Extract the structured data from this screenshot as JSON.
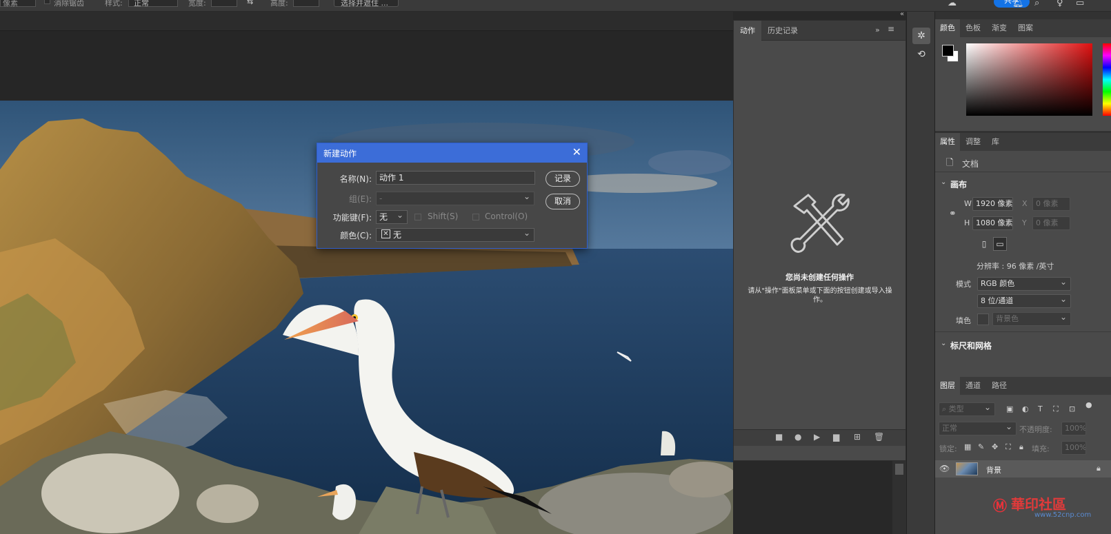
{
  "options_bar": {
    "px_label": "像素",
    "antialias_label": "消除锯齿",
    "style_label": "样式:",
    "style_value": "正常",
    "width_label": "宽度:",
    "height_label": "高度:",
    "swap_icon": "swap-arrow-icon",
    "select_mask_label": "选择并遮住 ...",
    "share_label": "共享"
  },
  "actions_panel": {
    "tabs": [
      "动作",
      "历史记录"
    ],
    "empty_title": "您尚未创建任何操作",
    "empty_desc": "请从\"操作\"面板菜单或下面的按钮创建或导入操作。"
  },
  "color_panel": {
    "tabs": [
      "颜色",
      "色板",
      "渐变",
      "图案"
    ],
    "foreground": "#000000",
    "background": "#ffffff"
  },
  "properties_panel": {
    "tabs": [
      "属性",
      "调整",
      "库"
    ],
    "doc_label": "文档",
    "canvas_section": "画布",
    "w_label": "W",
    "w_value": "1920 像素",
    "h_label": "H",
    "h_value": "1080 像素",
    "x_label": "X",
    "x_value": "0 像素",
    "y_label": "Y",
    "y_value": "0 像素",
    "resolution": "分辨率 : 96 像素 /英寸",
    "mode_label": "模式",
    "mode_value": "RGB 颜色",
    "depth_value": "8 位/通道",
    "fill_label": "填色",
    "fill_value": "背景色",
    "rulers_section": "标尺和网格"
  },
  "layers_panel": {
    "tabs": [
      "图层",
      "通道",
      "路径"
    ],
    "search_placeholder": "类型",
    "blend_mode": "正常",
    "opacity_label": "不透明度:",
    "opacity_value": "100%",
    "lock_label": "锁定:",
    "fill_label": "填充:",
    "fill_value": "100%",
    "layer_name": "背景"
  },
  "dialog": {
    "title": "新建动作",
    "name_label": "名称(N):",
    "name_value": "动作 1",
    "group_label": "组(E):",
    "group_value": "-",
    "fkey_label": "功能键(F):",
    "fkey_value": "无",
    "shift_label": "Shift(S)",
    "control_label": "Control(O)",
    "color_label": "颜色(C):",
    "color_value": "无",
    "record_button": "记录",
    "cancel_button": "取消"
  },
  "watermark": {
    "text": "華印社區",
    "url": "www.52cnp.com"
  }
}
